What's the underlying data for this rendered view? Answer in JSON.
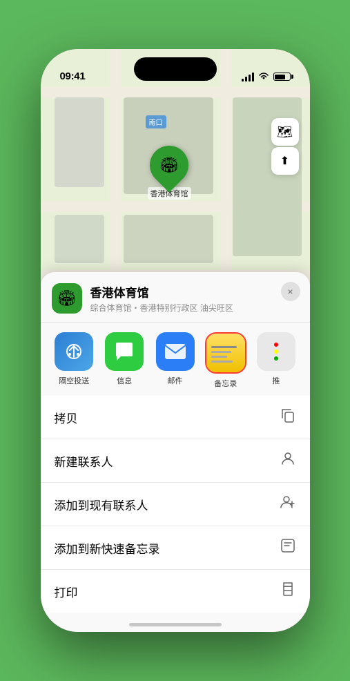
{
  "status": {
    "time": "09:41",
    "navigation_arrow": "▶"
  },
  "map": {
    "label": "南口",
    "controls": {
      "map_type_icon": "🗺",
      "location_icon": "⬆"
    }
  },
  "venue": {
    "name": "香港体育馆",
    "description": "综合体育馆・香港特别行政区 油尖旺区",
    "icon": "🏟",
    "marker_label": "香港体育馆"
  },
  "apps": [
    {
      "id": "airdrop",
      "label": "隔空投送",
      "icon": "📡"
    },
    {
      "id": "messages",
      "label": "信息",
      "icon": "💬"
    },
    {
      "id": "mail",
      "label": "邮件",
      "icon": "✉"
    },
    {
      "id": "notes",
      "label": "备忘录",
      "icon": ""
    },
    {
      "id": "more",
      "label": "推",
      "icon": ""
    }
  ],
  "actions": [
    {
      "label": "拷贝",
      "icon": "📋"
    },
    {
      "label": "新建联系人",
      "icon": "👤"
    },
    {
      "label": "添加到现有联系人",
      "icon": "👤"
    },
    {
      "label": "添加到新快速备忘录",
      "icon": "📝"
    },
    {
      "label": "打印",
      "icon": "🖨"
    }
  ],
  "close_label": "×",
  "colors": {
    "green": "#2e9b2e",
    "accent_blue": "#2b7ef5",
    "notes_yellow": "#ffe066",
    "notes_border": "#ff3b30"
  }
}
